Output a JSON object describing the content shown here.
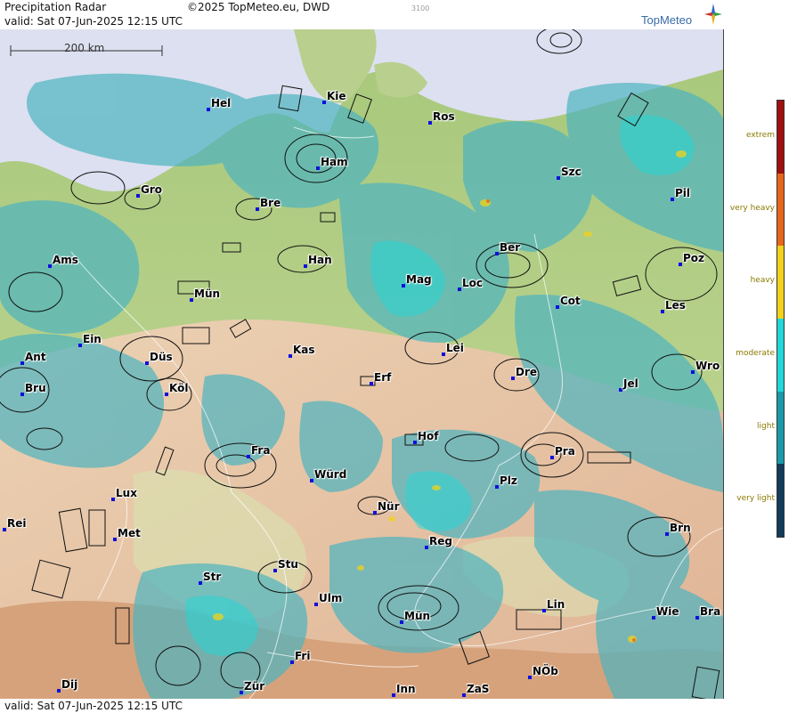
{
  "header": {
    "title": "Precipitation Radar",
    "copyright": "©2025 TopMeteo.eu, DWD",
    "small_code": "3100",
    "valid": "valid:  Sat  07-Jun-2025 12:15 UTC",
    "brand": "TopMeteo"
  },
  "scale": {
    "label": "200 km"
  },
  "footer": {
    "valid": "valid:  Sat  07-Jun-2025 12:15 UTC"
  },
  "cities": [
    {
      "name": "Hel"
    },
    {
      "name": "Kie"
    },
    {
      "name": "Ros"
    },
    {
      "name": "Ham"
    },
    {
      "name": "Szc"
    },
    {
      "name": "Gro"
    },
    {
      "name": "Bre"
    },
    {
      "name": "Pil"
    },
    {
      "name": "Ams"
    },
    {
      "name": "Han"
    },
    {
      "name": "Ber"
    },
    {
      "name": "Poz"
    },
    {
      "name": "Mün"
    },
    {
      "name": "Mag"
    },
    {
      "name": "Loc"
    },
    {
      "name": "Cot"
    },
    {
      "name": "Les"
    },
    {
      "name": "Ein"
    },
    {
      "name": "Kas"
    },
    {
      "name": "Lei"
    },
    {
      "name": "Ant"
    },
    {
      "name": "Düs"
    },
    {
      "name": "Dre"
    },
    {
      "name": "Wro"
    },
    {
      "name": "Bru"
    },
    {
      "name": "Köl"
    },
    {
      "name": "Erf"
    },
    {
      "name": "Jel"
    },
    {
      "name": "Hof"
    },
    {
      "name": "Fra"
    },
    {
      "name": "Pra"
    },
    {
      "name": "Würd"
    },
    {
      "name": "Plz"
    },
    {
      "name": "Lux"
    },
    {
      "name": "Nür"
    },
    {
      "name": "Rei"
    },
    {
      "name": "Met"
    },
    {
      "name": "Reg"
    },
    {
      "name": "Brn"
    },
    {
      "name": "Stu"
    },
    {
      "name": "Str"
    },
    {
      "name": "Ulm"
    },
    {
      "name": "Lin"
    },
    {
      "name": "Mün"
    },
    {
      "name": "Wie"
    },
    {
      "name": "Bra"
    },
    {
      "name": "Fri"
    },
    {
      "name": "Dij"
    },
    {
      "name": "Zür"
    },
    {
      "name": "Inn"
    },
    {
      "name": "ZaS"
    },
    {
      "name": "NÖb"
    }
  ],
  "legend": {
    "levels": [
      {
        "label": "extrem",
        "color": "#a01010"
      },
      {
        "label": "very heavy",
        "color": "#e8661a"
      },
      {
        "label": "heavy",
        "color": "#f2d21a"
      },
      {
        "label": "moderate",
        "color": "#20d8d8"
      },
      {
        "label": "light",
        "color": "#1a9aa8"
      },
      {
        "label": "very light",
        "color": "#123c5a"
      }
    ]
  },
  "colors": {
    "sea": "#dde0f0",
    "lowland": "#b4cf86",
    "highland": "#e8c4a6",
    "alps": "#d9a67f",
    "rain": "#4db4c0"
  }
}
